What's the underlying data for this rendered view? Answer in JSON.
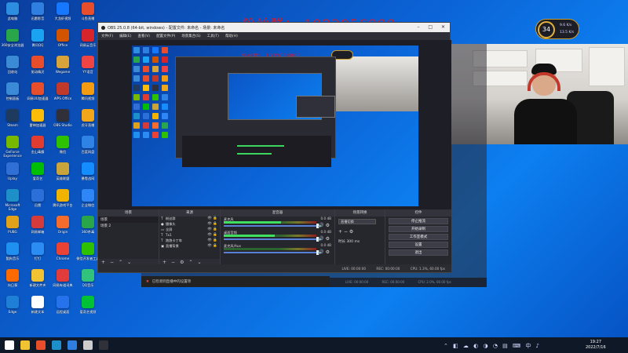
{
  "overlay": {
    "title": "粉丝群： 1032056998"
  },
  "badge": {
    "value": "34",
    "stats": [
      "9.6 K/s",
      "13.5 K/s"
    ]
  },
  "desktop": {
    "icons": [
      {
        "label": "此电脑",
        "color": "#2d8de0"
      },
      {
        "label": "迅雷影音",
        "color": "#2f7fe0"
      },
      {
        "label": "大龙虾视频",
        "color": "#1677ff"
      },
      {
        "label": "斗鱼直播",
        "color": "#e84d2c"
      },
      {
        "label": "360安全浏览器",
        "color": "#2aa64a"
      },
      {
        "label": "腾讯QQ",
        "color": "#19a3f0"
      },
      {
        "label": "Office",
        "color": "#d35400"
      },
      {
        "label": "网易云音乐",
        "color": "#d8252b"
      },
      {
        "label": "回收站",
        "color": "#3b8ad6"
      },
      {
        "label": "驱动精灵",
        "color": "#e84d2c"
      },
      {
        "label": "Wegame",
        "color": "#d8a33b"
      },
      {
        "label": "YY语音",
        "color": "#e44"
      },
      {
        "label": "控制面板",
        "color": "#3a8ad8"
      },
      {
        "label": "网易UU加速器",
        "color": "#e84d2c"
      },
      {
        "label": "WPS Office",
        "color": "#c0392b"
      },
      {
        "label": "腾讯视频",
        "color": "#f39c12"
      },
      {
        "label": "Steam",
        "color": "#1e3a5f"
      },
      {
        "label": "雷神加速器",
        "color": "#fbbd08"
      },
      {
        "label": "OBS Studio",
        "color": "#30303a"
      },
      {
        "label": "虎牙直播",
        "color": "#f2a71b"
      },
      {
        "label": "GeForce Experience",
        "color": "#76b900"
      },
      {
        "label": "金山毒霸",
        "color": "#e03c31"
      },
      {
        "label": "微信",
        "color": "#2dc100"
      },
      {
        "label": "百度网盘",
        "color": "#2e83e5"
      },
      {
        "label": "Uplay",
        "color": "#2f6fd6"
      },
      {
        "label": "爱奇艺",
        "color": "#00be06"
      },
      {
        "label": "英雄联盟",
        "color": "#c8a43a"
      },
      {
        "label": "暴雪战网",
        "color": "#148eff"
      },
      {
        "label": "Microsoft Edge",
        "color": "#1e90c9"
      },
      {
        "label": "迅雷",
        "color": "#2b6fdb"
      },
      {
        "label": "腾讯游戏平台",
        "color": "#f0b400"
      },
      {
        "label": "企业微信",
        "color": "#2f86f6"
      },
      {
        "label": "PUBG",
        "color": "#e0a21a"
      },
      {
        "label": "网易邮箱",
        "color": "#d63b3b"
      },
      {
        "label": "Origin",
        "color": "#f56c2d"
      },
      {
        "label": "360杀毒",
        "color": "#2aa64a"
      },
      {
        "label": "酷狗音乐",
        "color": "#1f8ff0"
      },
      {
        "label": "钉钉",
        "color": "#2b8cf3"
      },
      {
        "label": "Chrome",
        "color": "#ea4335"
      },
      {
        "label": "微信开发者工具",
        "color": "#2dc100"
      },
      {
        "label": "向日葵",
        "color": "#ff6a00"
      },
      {
        "label": "新建文件夹",
        "color": "#f1c232"
      },
      {
        "label": "网易有道词典",
        "color": "#e23b3b"
      },
      {
        "label": "QQ音乐",
        "color": "#31c27c"
      },
      {
        "label": "Edge",
        "color": "#1f7fd6"
      },
      {
        "label": "新建文本",
        "color": "#ffffff"
      },
      {
        "label": "远程桌面",
        "color": "#2672ec"
      },
      {
        "label": "爱奇艺视频",
        "color": "#00c234"
      }
    ]
  },
  "obs": {
    "title": "OBS 25.0.8 (64-bit, windows) - 配置文件: 未命名 - 场景: 未命名",
    "menu": [
      "文件(F)",
      "编辑(E)",
      "查看(V)",
      "配置文件(P)",
      "场景集合(S)",
      "工具(T)",
      "帮助(H)"
    ],
    "docks": {
      "scenes": {
        "title": "场景",
        "items": [
          "场景",
          "场景 2"
        ]
      },
      "sources": {
        "title": "来源",
        "items": [
          {
            "icon": "T",
            "name": "粉丝群"
          },
          {
            "icon": "●",
            "name": "摄像头"
          },
          {
            "icon": "▭",
            "name": "全屏"
          },
          {
            "icon": "T",
            "name": "Tx1"
          },
          {
            "icon": "T",
            "name": "跑跑卡丁车"
          },
          {
            "icon": "▣",
            "name": "直播背景"
          }
        ]
      },
      "mixer": {
        "title": "混音器",
        "channels": [
          {
            "name": "麦克风",
            "db": "0.0 dB",
            "level": 0.62
          },
          {
            "name": "桌面音频",
            "db": "0.0 dB",
            "level": 0.55
          },
          {
            "name": "麦克风/Aux",
            "db": "0.0 dB",
            "level": 0.0
          }
        ]
      },
      "transitions": {
        "title": "场景转换",
        "selected": "直播切换",
        "duration_label": "时长",
        "duration": "300 ms"
      },
      "controls": {
        "title": "控件",
        "buttons": [
          "停止推流",
          "开始录制",
          "工作室模式",
          "设置",
          "退出"
        ]
      }
    },
    "status": [
      "LIVE: 00:00:00",
      "REC: 00:00:00",
      "CPU: 1.3%, 60.00 fps"
    ]
  },
  "background_obs": {
    "notice": "已检测到直播中的设置项",
    "bar": [
      "LIVE: 00:00:00",
      "REC: 00:00:00",
      "CPU: 2.0%, 60.00 fps"
    ]
  },
  "taskbar": {
    "icons": [
      "#ffffff",
      "#f1c232",
      "#e84d2c",
      "#1e90c9",
      "#2f7fe0",
      "#cccccc",
      "#30303a"
    ],
    "time": "19:27",
    "date": "2022/7/16",
    "tray": "⌃ ◧ ☁ ◐ ◑ ◔ ▤ ⌨ 中 ♪"
  }
}
